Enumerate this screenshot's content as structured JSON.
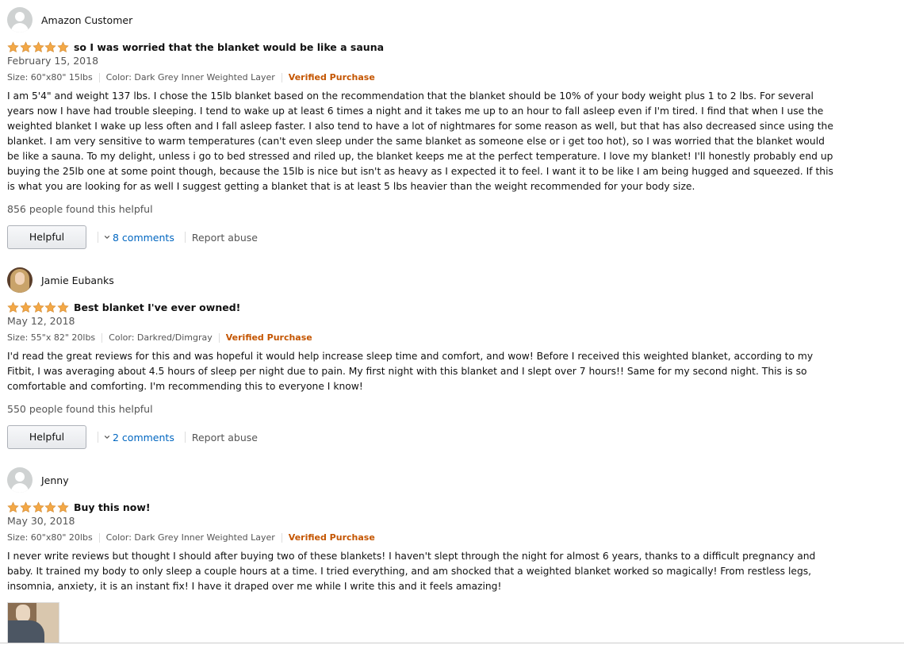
{
  "reviews": [
    {
      "profile_name": "Amazon Customer",
      "avatar": "generic-user-icon",
      "rating": 5,
      "title": "so I was worried that the blanket would be like a sauna",
      "date": "February 15, 2018",
      "size": "Size: 60\"x80\" 15lbs",
      "color": "Color: Dark Grey Inner Weighted Layer",
      "verified": "Verified Purchase",
      "body": "I am 5'4\" and weight 137 lbs. I chose the 15lb blanket based on the recommendation that the blanket should be 10% of your body weight plus 1 to 2 lbs. For several years now I have had trouble sleeping. I tend to wake up at least 6 times a night and it takes me up to an hour to fall asleep even if I'm tired. I find that when I use the weighted blanket I wake up less often and I fall asleep faster. I also tend to have a lot of nightmares for some reason as well, but that has also decreased since using the blanket. I am very sensitive to warm temperatures (can't even sleep under the same blanket as someone else or i get too hot), so I was worried that the blanket would be like a sauna. To my delight, unless i go to bed stressed and riled up, the blanket keeps me at the perfect temperature. I love my blanket! I'll honestly probably end up buying the 25lb one at some point though, because the 15lb is nice but isn't as heavy as I expected it to feel. I want it to be like I am being hugged and squeezed. If this is what you are looking for as well I suggest getting a blanket that is at least 5 lbs heavier than the weight recommended for your body size.",
      "helpful_text": "856 people found this helpful",
      "helpful_button": "Helpful",
      "comments": "8 comments",
      "report": "Report abuse"
    },
    {
      "profile_name": "Jamie Eubanks",
      "avatar": "profile-photo",
      "rating": 5,
      "title": "Best blanket I've ever owned!",
      "date": "May 12, 2018",
      "size": "Size: 55\"x 82\" 20lbs",
      "color": "Color: Darkred/Dimgray",
      "verified": "Verified Purchase",
      "body": "I'd read the great reviews for this and was hopeful it would help increase sleep time and comfort, and wow! Before I received this weighted blanket, according to my Fitbit, I was averaging about 4.5 hours of sleep per night due to pain. My first night with this blanket and I slept over 7 hours!! Same for my second night. This is so comfortable and comforting. I'm recommending this to everyone I know!",
      "helpful_text": "550 people found this helpful",
      "helpful_button": "Helpful",
      "comments": "2 comments",
      "report": "Report abuse"
    },
    {
      "profile_name": "Jenny",
      "avatar": "generic-user-icon",
      "rating": 5,
      "title": "Buy this now!",
      "date": "May 30, 2018",
      "size": "Size: 60\"x80\" 20lbs",
      "color": "Color: Dark Grey Inner Weighted Layer",
      "verified": "Verified Purchase",
      "body": "I never write reviews but thought I should after buying two of these blankets! I haven't slept through the night for almost 6 years, thanks to a difficult pregnancy and baby. It trained my body to only sleep a couple hours at a time. I tried everything, and am shocked that a weighted blanket worked so magically! From restless legs, insomnia, anxiety, it is an instant fix! I have it draped over me while I write this and it feels amazing!",
      "image": "customer-review-photo"
    }
  ],
  "colors": {
    "star": "#f3a847",
    "verified": "#c45500",
    "link": "#0066c0",
    "muted": "#555555"
  }
}
